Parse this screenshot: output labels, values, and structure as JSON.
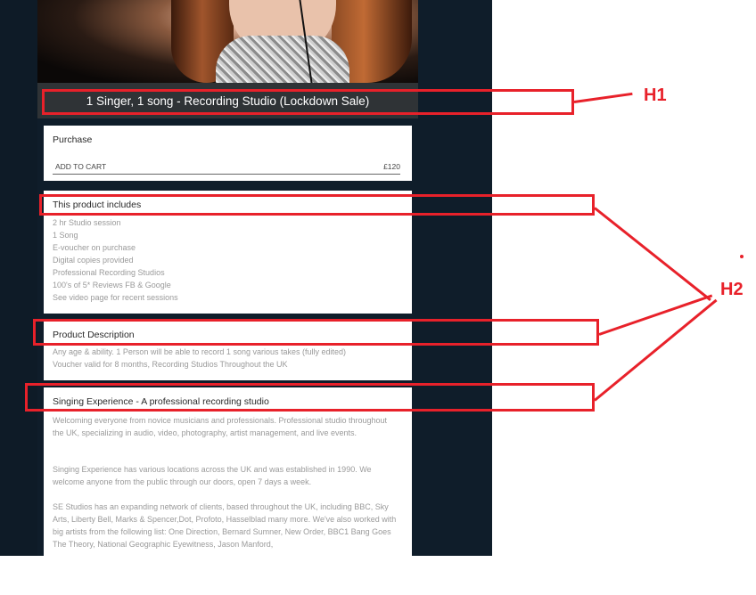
{
  "product": {
    "title": "1 Singer, 1 song - Recording Studio (Lockdown Sale)"
  },
  "purchase": {
    "title": "Purchase",
    "add_to_cart": "ADD TO CART",
    "price": "£120"
  },
  "includes": {
    "title": "This product includes",
    "items": [
      "2 hr Studio session",
      "1 Song",
      "E-voucher on purchase",
      "Digital copies provided",
      "Professional Recording Studios",
      "100's of 5* Reviews FB & Google",
      "See video page for recent sessions"
    ]
  },
  "description": {
    "title": "Product Description",
    "lines": [
      "Any age & ability. 1 Person will be able to record 1 song various takes (fully edited)",
      "Voucher valid for 8 months, Recording Studios Throughout the UK"
    ]
  },
  "experience": {
    "title": "Singing Experience - A professional recording studio",
    "paragraphs": [
      "Welcoming everyone from novice musicians and professionals. Professional studio throughout the UK, specializing in audio, video, photography, artist management, and live events.",
      "Singing Experience has various locations across the UK and was established in 1990. We welcome anyone from the public through our doors, open 7 days a week.",
      "SE Studios has an expanding network of clients, based throughout the UK, including BBC, Sky Arts, Liberty Bell, Marks & Spencer,Dot, Profoto, Hasselblad many more. We've also worked with big artists from the following list: One Direction, Bernard Sumner, New Order, BBC1 Bang Goes The Theory, National Geographic Eyewitness, Jason Manford,"
    ]
  },
  "annotations": {
    "h1": "H1",
    "h2": "H2",
    "color": "#e8212a"
  }
}
